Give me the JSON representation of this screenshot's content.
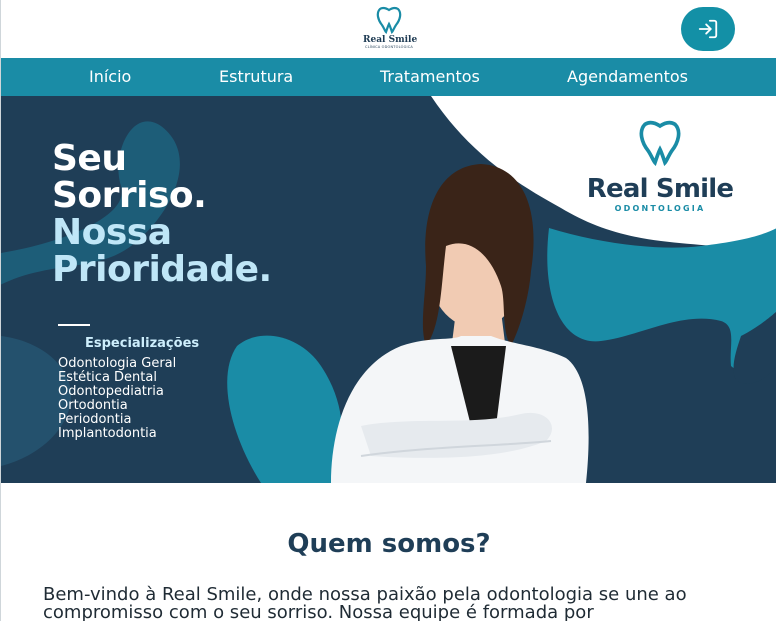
{
  "header": {
    "logo_name": "Real Smile",
    "logo_subtitle": "CLÍNICA ODONTOLÓGICA",
    "login_icon": "login-icon"
  },
  "nav": {
    "items": [
      "Início",
      "Estrutura",
      "Tratamentos",
      "Agendamentos"
    ]
  },
  "hero": {
    "headline": [
      "Seu",
      "Sorriso.",
      "Nossa",
      "Prioridade."
    ],
    "specializations_title": "Especializações",
    "specializations": [
      "Odontologia Geral",
      "Estética Dental",
      "Odontopediatria",
      "Ortodontia",
      "Periodontia",
      "Implantodontia"
    ],
    "brand_name": "Real Smile",
    "brand_tagline": "ODONTOLOGIA"
  },
  "about": {
    "title": "Quem somos?",
    "text": "Bem-vindo à Real Smile, onde nossa paixão pela odontologia se une ao compromisso com o seu sorriso. Nossa equipe é formada por"
  },
  "colors": {
    "primary": "#1a8ca6",
    "dark": "#1f3e57",
    "light_text": "#bfe6f7"
  }
}
